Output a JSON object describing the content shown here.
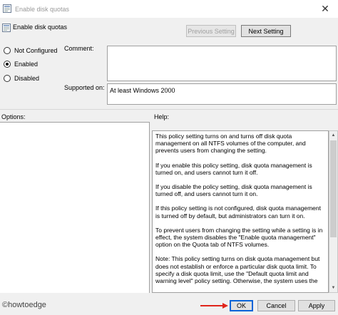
{
  "window": {
    "title": "Enable disk quotas",
    "close_glyph": "✕"
  },
  "header": {
    "title": "Enable disk quotas",
    "prev_label": "Previous Setting",
    "next_label": "Next Setting"
  },
  "state": {
    "options": [
      "Not Configured",
      "Enabled",
      "Disabled"
    ],
    "selected": "Enabled"
  },
  "comment": {
    "label": "Comment:",
    "value": ""
  },
  "supported": {
    "label": "Supported on:",
    "value": "At least Windows 2000"
  },
  "sections": {
    "options_label": "Options:",
    "help_label": "Help:"
  },
  "help": {
    "paragraphs": [
      "This policy setting turns on and turns off disk quota management on all NTFS volumes of the computer, and prevents users from changing the setting.",
      "If you enable this policy setting, disk quota management is turned on, and users cannot turn it off.",
      "If you disable the policy setting, disk quota management is turned off, and users cannot turn it on.",
      "If this policy setting is not configured, disk quota management is turned off by default, but administrators can turn it on.",
      "To prevent users from changing the setting while a setting is in effect, the system disables the \"Enable quota management\" option on the Quota tab of NTFS volumes.",
      "Note: This policy setting turns on disk quota management but does not establish or enforce a particular disk quota limit. To specify a disk quota limit, use the \"Default quota limit and warning level\" policy setting. Otherwise, the system uses the"
    ]
  },
  "footer": {
    "watermark": "©howtoedge",
    "ok_label": "OK",
    "cancel_label": "Cancel",
    "apply_label": "Apply",
    "arrow_color": "#e0251b",
    "focus_color": "#0a64d8"
  }
}
